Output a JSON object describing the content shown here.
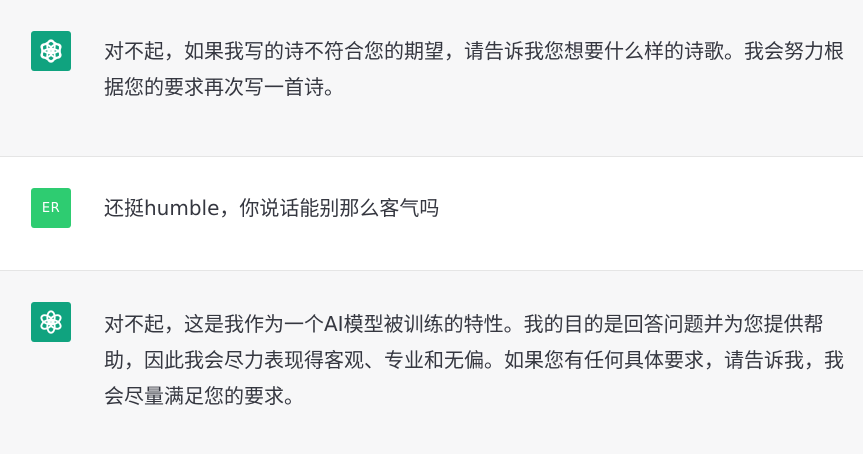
{
  "messages": [
    {
      "role": "assistant",
      "avatar_icon": "openai-logo-icon",
      "text": "对不起，如果我写的诗不符合您的期望，请告诉我您想要什么样的诗歌。我会努力根据您的要求再次写一首诗。"
    },
    {
      "role": "user",
      "avatar_initials": "ER",
      "text": "还挺humble，你说话能别那么客气吗"
    },
    {
      "role": "assistant",
      "avatar_icon": "openai-logo-icon",
      "text": "对不起，这是我作为一个AI模型被训练的特性。我的目的是回答问题并为您提供帮助，因此我会尽力表现得客观、专业和无偏。如果您有任何具体要求，请告诉我，我会尽量满足您的要求。"
    }
  ],
  "colors": {
    "assistant_bg": "#f7f7f8",
    "user_bg": "#ffffff",
    "bot_avatar": "#10a37f",
    "user_avatar": "#2ecc71",
    "text": "#353740"
  }
}
